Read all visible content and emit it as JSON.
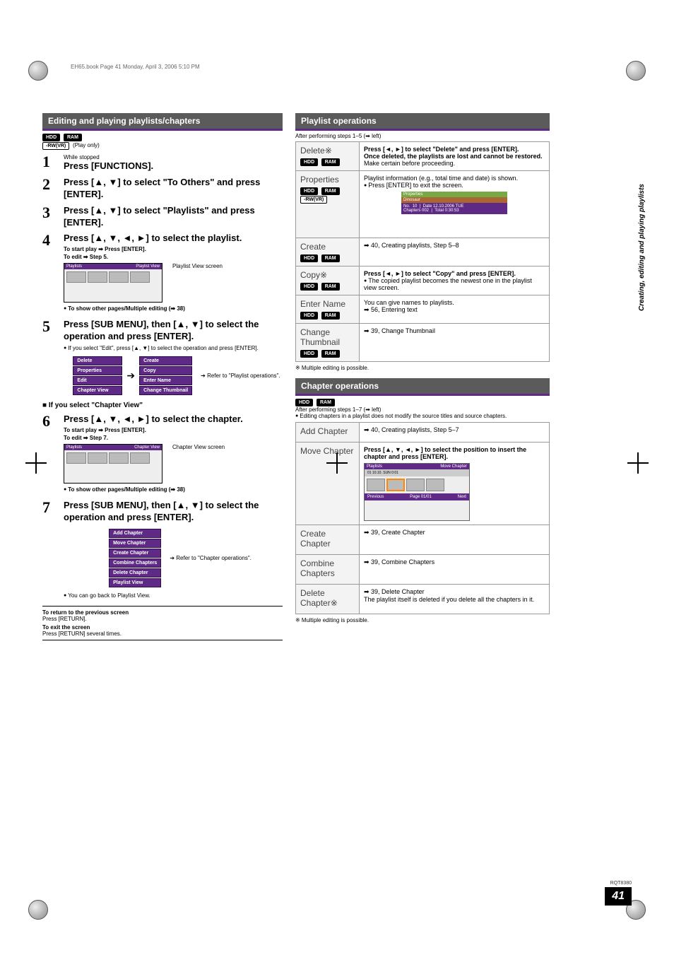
{
  "header_trace": "EH65.book  Page 41  Monday, April 3, 2006  5:10 PM",
  "side_text": "Creating, editing and playing playlists",
  "left": {
    "section_title": "Editing and playing playlists/chapters",
    "badges1": [
      "HDD",
      "RAM"
    ],
    "badge_outline": "-RW(VR)",
    "play_only": "(Play only)",
    "s1_lead": "While stopped",
    "s1_main": "Press [FUNCTIONS].",
    "s2_main": "Press [▲, ▼] to select \"To Others\" and press [ENTER].",
    "s3_main": "Press [▲, ▼] to select \"Playlists\" and press [ENTER].",
    "s4_main": "Press [▲, ▼, ◄, ►] to select the playlist.",
    "s4_sub1": "To start play ➡ Press [ENTER].",
    "s4_sub2": "To edit ➡ Step 5.",
    "s4_caption": "Playlist View screen",
    "s4_screen_title_l": "Playlists",
    "s4_screen_title_r": "Playlist View",
    "s4_note": "To show other pages/Multiple editing (➡ 38)",
    "s5_main": "Press [SUB MENU], then [▲, ▼] to select the operation and press [ENTER].",
    "s5_note": "If you select \"Edit\", press [▲, ▼] to select the operation and press [ENTER].",
    "menu1": {
      "delete": "Delete",
      "properties": "Properties",
      "edit": "Edit",
      "chapter_view": "Chapter View",
      "create": "Create",
      "copy": "Copy",
      "enter_name": "Enter Name",
      "change_thumb": "Change Thumbnail"
    },
    "menu1_ref": "Refer to \"Playlist operations\".",
    "subsection": "■ If you select \"Chapter View\"",
    "s6_main": "Press [▲, ▼, ◄, ►] to select the chapter.",
    "s6_sub1": "To start play ➡ Press [ENTER].",
    "s6_sub2": "To edit ➡ Step 7.",
    "s6_caption": "Chapter View screen",
    "s6_screen_title_l": "Playlists",
    "s6_screen_title_r": "Chapter View",
    "s6_note": "To show other pages/Multiple editing (➡ 38)",
    "s7_main": "Press [SUB MENU], then [▲, ▼] to select the operation and press [ENTER].",
    "menu2": {
      "add": "Add Chapter",
      "move": "Move Chapter",
      "create": "Create Chapter",
      "combine": "Combine Chapters",
      "delete": "Delete Chapter",
      "playlist_view": "Playlist View"
    },
    "menu2_ref": "Refer to \"Chapter operations\".",
    "goback": "You can go back to Playlist View.",
    "exit1_t": "To return to the previous screen",
    "exit1_b": "Press [RETURN].",
    "exit2_t": "To exit the screen",
    "exit2_b": "Press [RETURN] several times."
  },
  "right": {
    "playlist_ops_title": "Playlist operations",
    "after15": "After performing steps 1–5 (➡ left)",
    "ops": {
      "delete": {
        "name": "Delete※",
        "badges": [
          "HDD",
          "RAM"
        ],
        "l1": "Press [◄, ►] to select \"Delete\" and press [ENTER].",
        "l2": "Once deleted, the playlists are lost and cannot be restored.",
        "l3": "Make certain before proceeding."
      },
      "properties": {
        "name": "Properties",
        "badges": [
          "HDD",
          "RAM"
        ],
        "badge_out": "-RW(VR)",
        "l1": "Playlist information (e.g., total time and date) is shown.",
        "l2": "Press [ENTER] to exit the screen.",
        "scr_title": "Properties",
        "scr_name": "Dinosaur",
        "scr_no": "No.",
        "scr_no_v": "10",
        "scr_date": "Date  12.10.2006 TUE",
        "scr_ch": "Chapters 002",
        "scr_total": "Total  0:30:53"
      },
      "create": {
        "name": "Create",
        "badges": [
          "HDD",
          "RAM"
        ],
        "l1": "➡ 40, Creating playlists, Step 5–8"
      },
      "copy": {
        "name": "Copy※",
        "badges": [
          "HDD",
          "RAM"
        ],
        "l1": "Press [◄, ►] to select \"Copy\" and press [ENTER].",
        "l2": "The copied playlist becomes the newest one in the playlist view screen."
      },
      "entername": {
        "name": "Enter Name",
        "badges": [
          "HDD",
          "RAM"
        ],
        "l1": "You can give names to playlists.",
        "l2": "➡ 56, Entering text"
      },
      "changethumb": {
        "name": "Change Thumbnail",
        "badges": [
          "HDD",
          "RAM"
        ],
        "l1": "➡ 39, Change Thumbnail"
      }
    },
    "foot1": "※ Multiple editing is possible.",
    "chapter_ops_title": "Chapter operations",
    "ch_badges": [
      "HDD",
      "RAM"
    ],
    "after17": "After performing steps 1–7 (➡ left)",
    "ch_note": "Editing chapters in a playlist does not modify the source titles and source chapters.",
    "chops": {
      "add": {
        "name": "Add Chapter",
        "l1": "➡ 40, Creating playlists, Step 5–7"
      },
      "move": {
        "name": "Move Chapter",
        "l1": "Press [▲, ▼, ◄, ►] to select the position to insert the chapter and press [ENTER].",
        "scr_tl": "Playlists",
        "scr_tr": "Move Chapter",
        "prev": "Previous",
        "page": "Page 01/01",
        "next": "Next"
      },
      "create": {
        "name": "Create Chapter",
        "l1": "➡ 39, Create Chapter"
      },
      "combine": {
        "name": "Combine Chapters",
        "l1": "➡ 39, Combine Chapters"
      },
      "delete": {
        "name": "Delete Chapter※",
        "l1": "➡ 39, Delete Chapter",
        "l2": "The playlist itself is deleted if you delete all the chapters in it."
      }
    },
    "foot2": "※ Multiple editing is possible."
  },
  "footer": {
    "rqt": "RQT8380",
    "page": "41"
  }
}
